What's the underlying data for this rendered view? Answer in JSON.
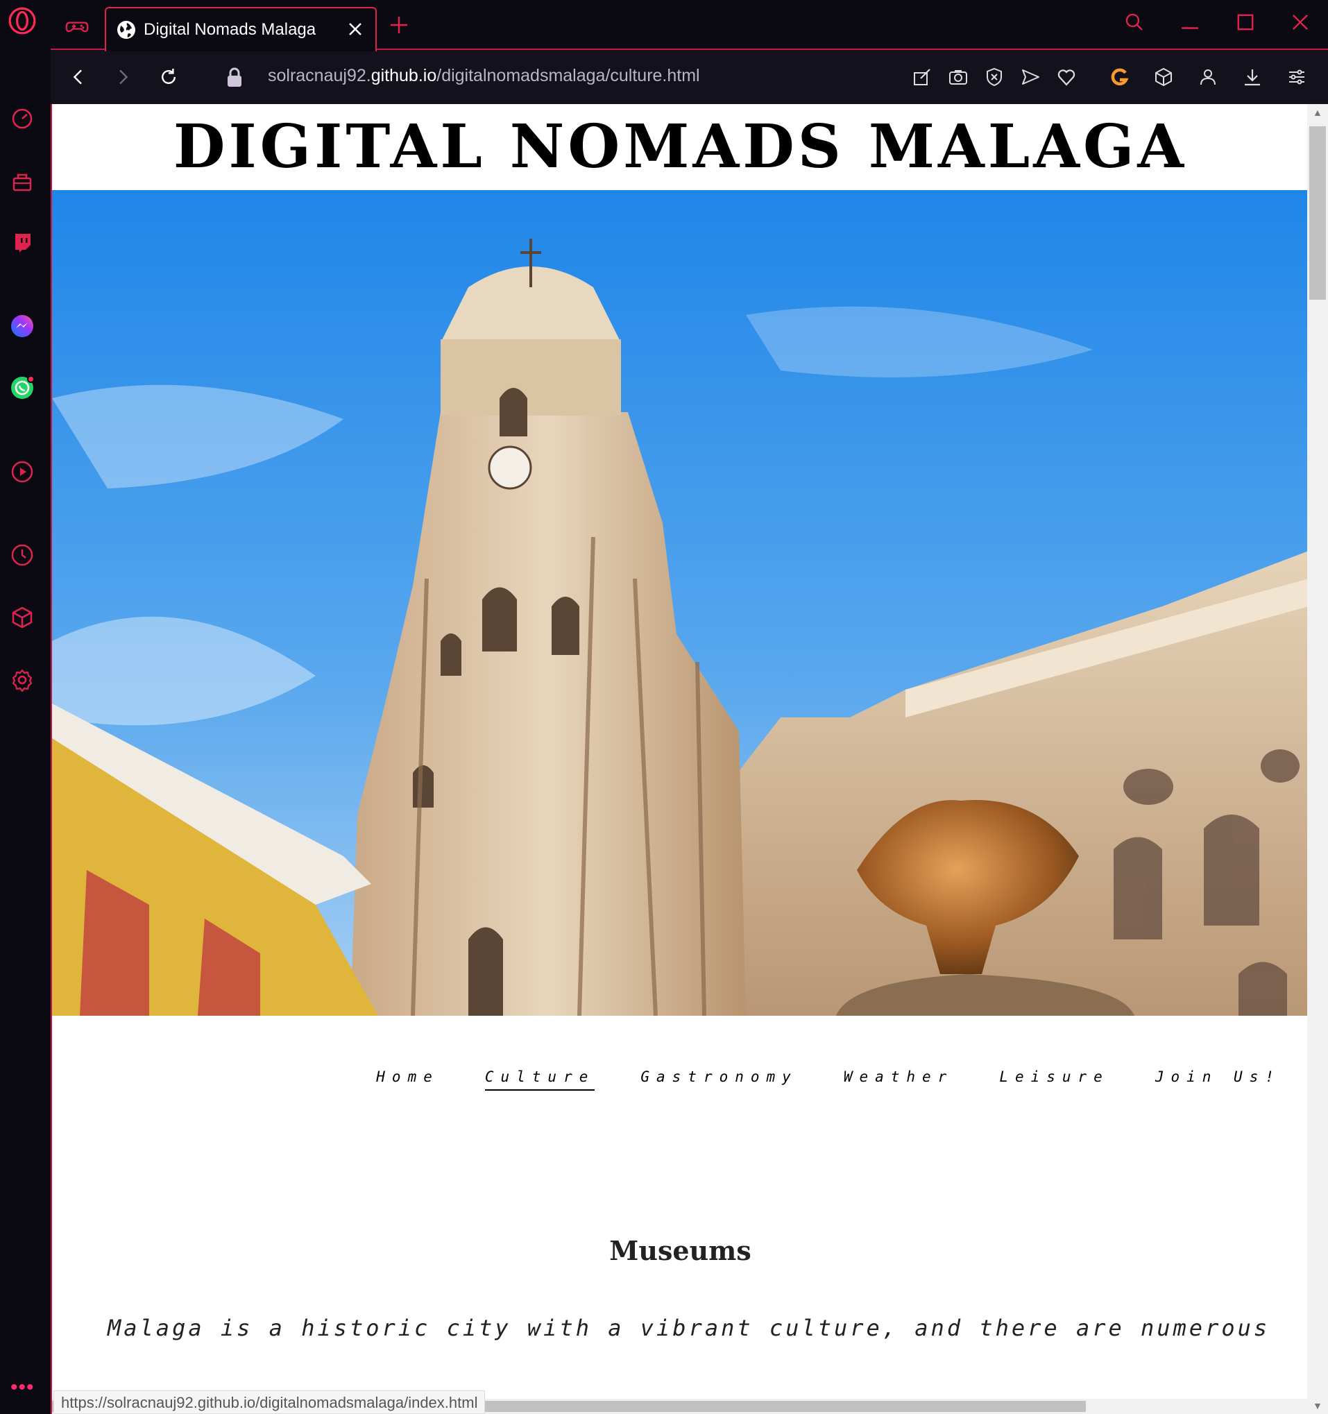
{
  "browser": {
    "tab_title": "Digital Nomads Malaga",
    "url_prefix": "solracnauj92.",
    "url_host": "github.io",
    "url_path": "/digitalnomadsmalaga/culture.html",
    "status_url": "https://solracnauj92.github.io/digitalnomadsmalaga/index.html",
    "accent_color": "#e0224f"
  },
  "sidebar": {
    "items": [
      {
        "icon": "speed-dial-icon"
      },
      {
        "icon": "shopping-corner-icon"
      },
      {
        "icon": "twitch-icon"
      },
      {
        "icon": "messenger-icon"
      },
      {
        "icon": "whatsapp-icon"
      },
      {
        "icon": "player-icon"
      },
      {
        "icon": "history-icon"
      },
      {
        "icon": "extensions-icon"
      },
      {
        "icon": "settings-icon"
      }
    ],
    "more_label": "•••"
  },
  "page": {
    "site_title": "DIGITAL NOMADS MALAGA",
    "nav": [
      {
        "label": "Home",
        "active": false
      },
      {
        "label": "Culture",
        "active": true
      },
      {
        "label": "Gastronomy",
        "active": false
      },
      {
        "label": "Weather",
        "active": false
      },
      {
        "label": "Leisure",
        "active": false
      },
      {
        "label": "Join Us!",
        "active": false
      }
    ],
    "section_title": "Museums",
    "intro_text": "Malaga is a historic city with a vibrant culture, and there are numerous"
  }
}
